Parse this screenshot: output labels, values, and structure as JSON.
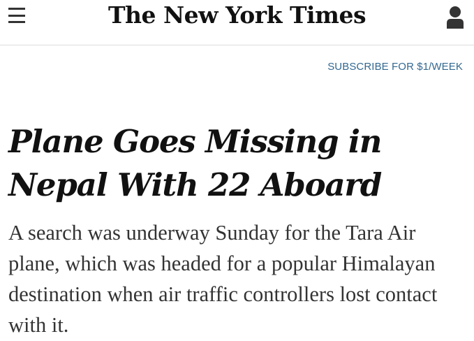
{
  "header": {
    "menu_icon": "hamburger-menu-icon",
    "masthead": "The New York Times",
    "account_icon": "user-account-icon"
  },
  "subscribe": {
    "label": "SUBSCRIBE FOR $1/WEEK",
    "color": "#326891"
  },
  "article": {
    "headline": "Plane Goes Missing in Nepal With 22 Aboard",
    "summary": "A search was underway Sunday for the Tara Air plane, which was headed for a popular Himalayan destination when air traffic controllers lost contact with it."
  }
}
